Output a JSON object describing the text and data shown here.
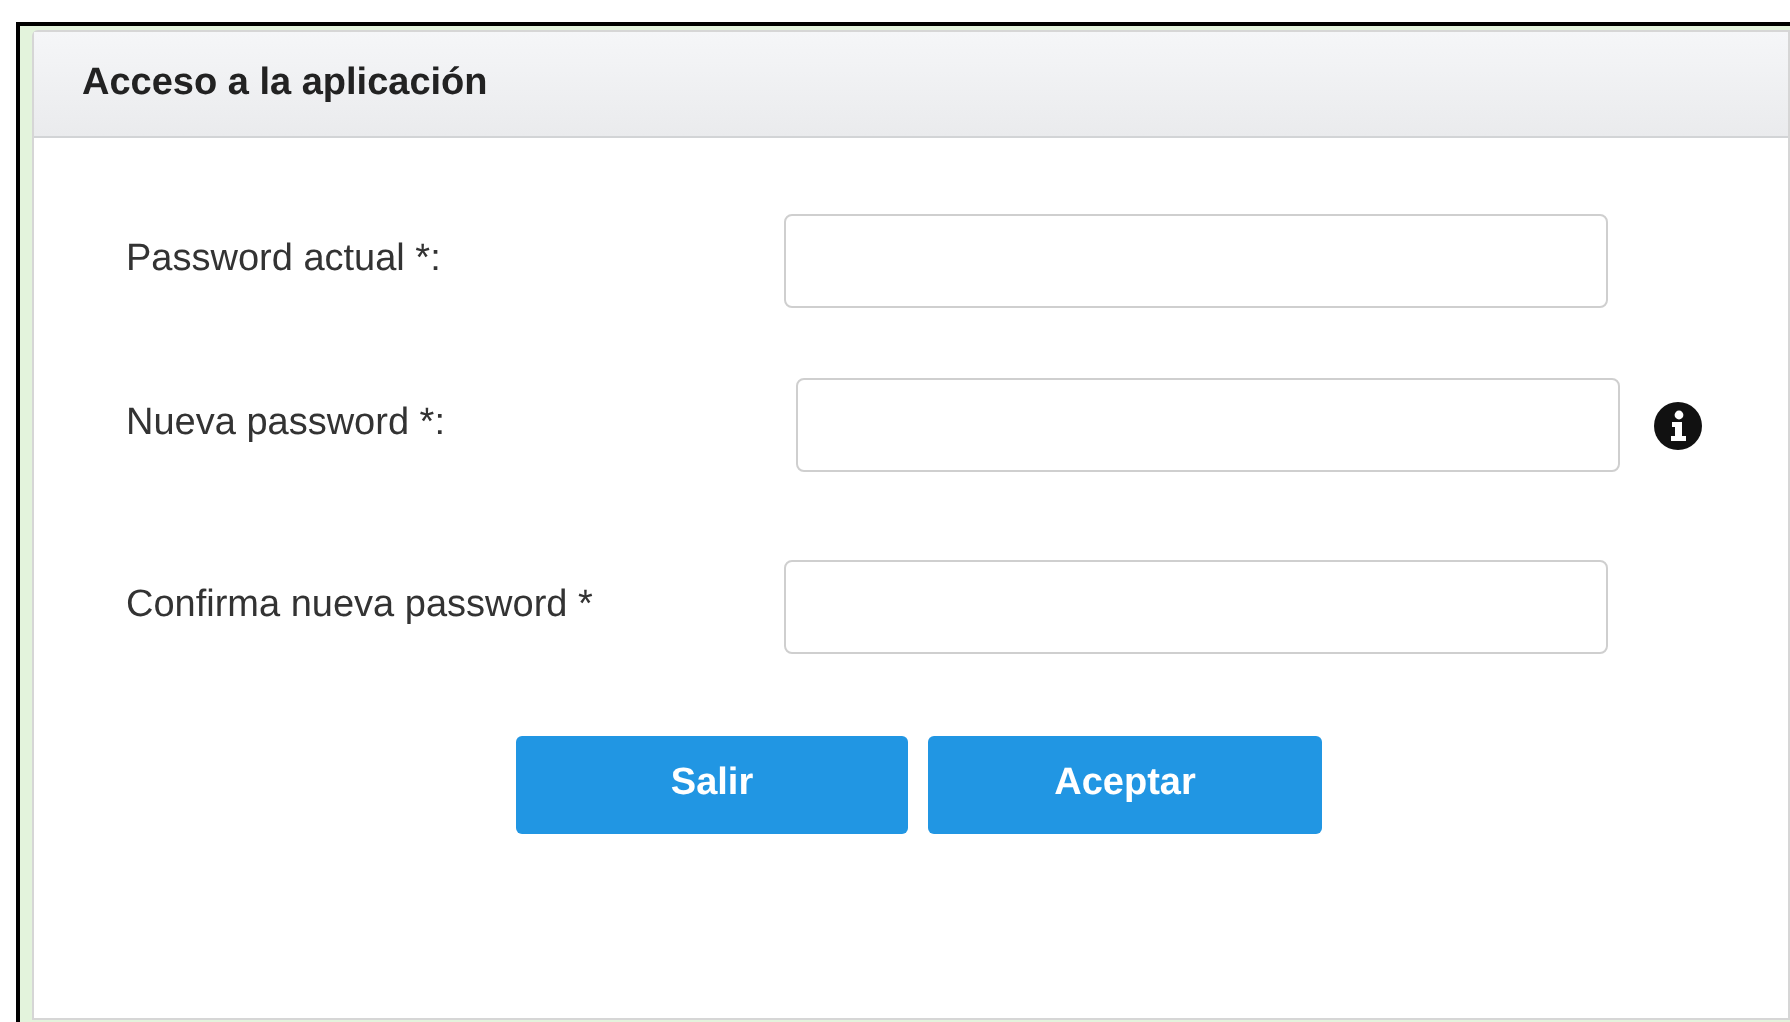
{
  "dialog": {
    "title": "Acceso a la aplicación"
  },
  "fields": [
    {
      "label": "Password actual *:",
      "info_icon": false
    },
    {
      "label": "Nueva password *:",
      "info_icon": true
    },
    {
      "label": "Confirma nueva password *",
      "info_icon": false
    }
  ],
  "buttons": [
    "Salir",
    "Aceptar"
  ]
}
